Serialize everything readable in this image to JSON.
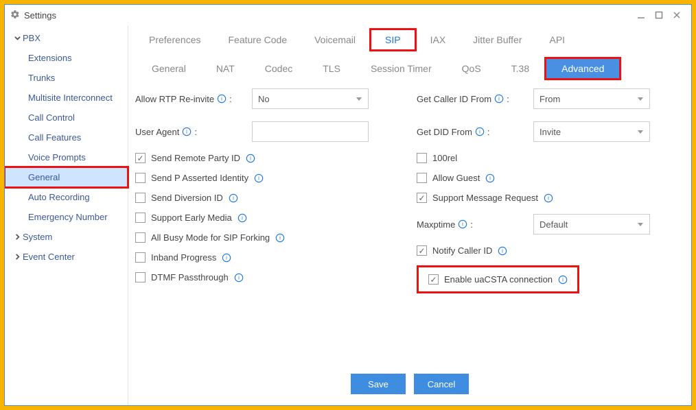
{
  "window": {
    "title": "Settings"
  },
  "sidebar": {
    "roots": [
      {
        "label": "PBX",
        "expanded": true,
        "children": [
          "Extensions",
          "Trunks",
          "Multisite Interconnect",
          "Call Control",
          "Call Features",
          "Voice Prompts",
          "General",
          "Auto Recording",
          "Emergency Number"
        ],
        "selectedChild": "General"
      },
      {
        "label": "System",
        "expanded": false
      },
      {
        "label": "Event Center",
        "expanded": false
      }
    ]
  },
  "tabs": {
    "items": [
      "Preferences",
      "Feature Code",
      "Voicemail",
      "SIP",
      "IAX",
      "Jitter Buffer",
      "API"
    ],
    "active": "SIP"
  },
  "subtabs": {
    "items": [
      "General",
      "NAT",
      "Codec",
      "TLS",
      "Session Timer",
      "QoS",
      "T.38",
      "Advanced"
    ],
    "active": "Advanced"
  },
  "form": {
    "left": {
      "allow_rtp_label": "Allow RTP Re-invite",
      "allow_rtp_value": "No",
      "user_agent_label": "User Agent",
      "user_agent_value": "",
      "cb1": "Send Remote Party ID",
      "cb2": "Send P Asserted Identity",
      "cb3": "Send Diversion ID",
      "cb4": "Support Early Media",
      "cb5": "All Busy Mode for SIP Forking",
      "cb6": "Inband Progress",
      "cb7": "DTMF Passthrough"
    },
    "right": {
      "caller_id_label": "Get Caller ID From",
      "caller_id_value": "From",
      "did_label": "Get DID From",
      "did_value": "Invite",
      "cb1": "100rel",
      "cb2": "Allow Guest",
      "cb3": "Support Message Request",
      "maxptime_label": "Maxptime",
      "maxptime_value": "Default",
      "cb4": "Notify Caller ID",
      "cb5": "Enable uaCSTA connection"
    }
  },
  "buttons": {
    "save": "Save",
    "cancel": "Cancel"
  },
  "colon": ":"
}
